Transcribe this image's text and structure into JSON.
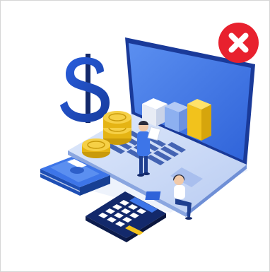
{
  "dialog": {
    "illustration_name": "finance-laptop-illustration",
    "colors": {
      "close_button": "#e8212e",
      "primary_blue": "#1f4fd1",
      "dark_navy": "#13296b",
      "screen_blue": "#3d75e8",
      "gold": "#f2c21c",
      "bill_green": "#2d5fc9"
    },
    "icons": {
      "close": "close-x-icon",
      "dollar": "dollar-sign-icon",
      "coins": "coin-stack-icon",
      "money": "banknote-stack-icon",
      "calculator": "calculator-icon",
      "laptop": "laptop-icon",
      "chart": "bar-chart-icon",
      "people": "person-icon"
    }
  }
}
